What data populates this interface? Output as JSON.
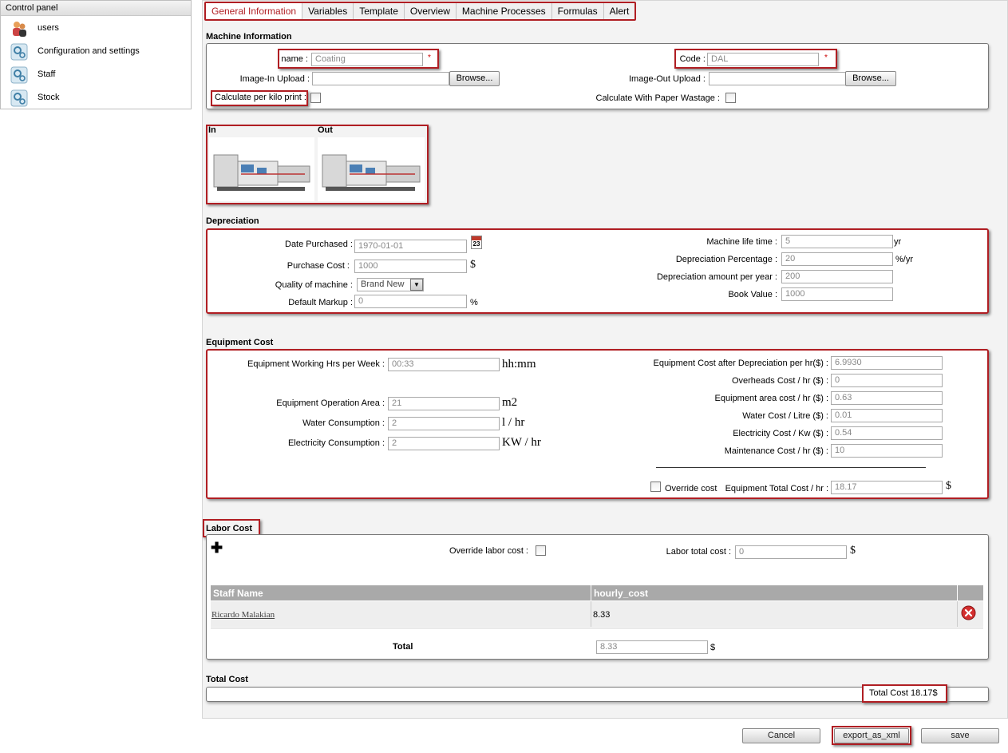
{
  "sidebar": {
    "title": "Control panel",
    "items": [
      {
        "label": "users",
        "icon": "users-icon"
      },
      {
        "label": "Configuration and settings",
        "icon": "settings-gear-icon"
      },
      {
        "label": "Staff",
        "icon": "settings-gear-icon"
      },
      {
        "label": "Stock",
        "icon": "settings-gear-icon"
      }
    ]
  },
  "tabs": [
    "General Information",
    "Variables",
    "Template",
    "Overview",
    "Machine Processes",
    "Formulas",
    "Alert"
  ],
  "active_tab": "General Information",
  "machine_info": {
    "title": "Machine Information",
    "name_label": "name :",
    "name_value": "Coating",
    "code_label": "Code :",
    "code_value": "DAL",
    "image_in_label": "Image-In Upload :",
    "image_out_label": "Image-Out Upload :",
    "browse_label": "Browse...",
    "calc_per_kilo_label": "Calculate per kilo print :",
    "calc_paper_wastage_label": "Calculate With Paper Wastage :",
    "required_mark": "*"
  },
  "images": {
    "in_label": "In",
    "out_label": "Out"
  },
  "depreciation": {
    "title": "Depreciation",
    "date_purchased_label": "Date Purchased :",
    "date_purchased_value": "1970-01-01",
    "calendar_day": "23",
    "purchase_cost_label": "Purchase Cost :",
    "purchase_cost_value": "1000",
    "purchase_cost_unit": "$",
    "quality_label": "Quality of machine :",
    "quality_value": "Brand New",
    "default_markup_label": "Default Markup :",
    "default_markup_value": "0",
    "default_markup_unit": "%",
    "life_time_label": "Machine life time :",
    "life_time_value": "5",
    "life_time_unit": "yr",
    "dep_percentage_label": "Depreciation Percentage :",
    "dep_percentage_value": "20",
    "dep_percentage_unit": "%/yr",
    "dep_amount_label": "Depreciation amount per year :",
    "dep_amount_value": "200",
    "book_value_label": "Book Value :",
    "book_value_value": "1000"
  },
  "equipment_cost": {
    "title": "Equipment Cost",
    "working_hrs_label": "Equipment Working Hrs per Week :",
    "working_hrs_value": "00:33",
    "working_hrs_unit": "hh:mm",
    "operation_area_label": "Equipment Operation Area :",
    "operation_area_value": "21",
    "operation_area_unit": "m2",
    "water_label": "Water Consumption :",
    "water_value": "2",
    "water_unit": "l / hr",
    "electricity_label": "Electricity Consumption :",
    "electricity_value": "2",
    "electricity_unit": "KW / hr",
    "cost_after_dep_label": "Equipment Cost after Depreciation per hr($) :",
    "cost_after_dep_value": "6.9930",
    "overheads_label": "Overheads Cost / hr ($) :",
    "overheads_value": "0",
    "area_cost_label": "Equipment area cost / hr ($) :",
    "area_cost_value": "0.63",
    "water_cost_label": "Water Cost / Litre ($) :",
    "water_cost_value": "0.01",
    "elec_cost_label": "Electricity Cost / Kw ($) :",
    "elec_cost_value": "0.54",
    "maintenance_label": "Maintenance Cost / hr ($) :",
    "maintenance_value": "10",
    "override_label": "Override cost",
    "total_label": "Equipment Total Cost / hr :",
    "total_value": "18.17",
    "total_unit": "$"
  },
  "labor_cost": {
    "title": "Labor Cost",
    "override_label": "Override labor cost :",
    "total_label": "Labor total cost :",
    "total_value": "0",
    "total_unit": "$",
    "columns": [
      "Staff Name",
      "hourly_cost"
    ],
    "rows": [
      {
        "name": "Ricardo Malakian",
        "hourly_cost": "8.33"
      }
    ],
    "footer_label": "Total",
    "footer_value": "8.33",
    "footer_unit": "$"
  },
  "total_cost": {
    "title": "Total Cost",
    "value_text": "Total Cost 18.17$"
  },
  "buttons": {
    "cancel": "Cancel",
    "export": "export_as_xml",
    "save": "save"
  },
  "colors": {
    "highlight_red": "#b01e23",
    "header_gray": "#a9a9a9"
  }
}
